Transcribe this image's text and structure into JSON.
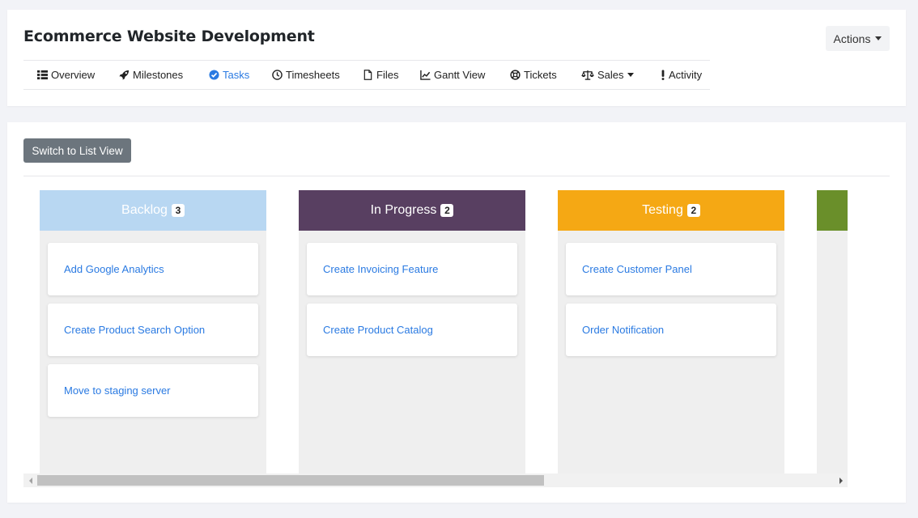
{
  "header": {
    "title": "Ecommerce Website Development",
    "actions_label": "Actions",
    "tabs": [
      {
        "label": "Overview",
        "icon": "list-icon",
        "active": false
      },
      {
        "label": "Milestones",
        "icon": "rocket-icon",
        "active": false
      },
      {
        "label": "Tasks",
        "icon": "check-circle-icon",
        "active": true
      },
      {
        "label": "Timesheets",
        "icon": "clock-icon",
        "active": false
      },
      {
        "label": "Files",
        "icon": "file-icon",
        "active": false
      },
      {
        "label": "Gantt View",
        "icon": "chart-line-icon",
        "active": false
      },
      {
        "label": "Tickets",
        "icon": "life-ring-icon",
        "active": false
      },
      {
        "label": "Sales",
        "icon": "balance-scale-icon",
        "active": false
      },
      {
        "label": "Activity",
        "icon": "exclamation-icon",
        "active": false
      }
    ]
  },
  "board": {
    "switch_label": "Switch to List View",
    "columns": [
      {
        "title": "Backlog",
        "count": "3",
        "color": "#b8d7f2",
        "tasks": [
          "Add Google Analytics",
          "Create Product Search Option",
          "Move to staging server"
        ]
      },
      {
        "title": "In Progress",
        "count": "2",
        "color": "#583f61",
        "tasks": [
          "Create Invoicing Feature",
          "Create Product Catalog"
        ]
      },
      {
        "title": "Testing",
        "count": "2",
        "color": "#f5a814",
        "tasks": [
          "Create Customer Panel",
          "Order Notification"
        ]
      },
      {
        "title": "",
        "count": "",
        "color": "#6a8f2a",
        "tasks": []
      }
    ]
  },
  "colors": {
    "link": "#2a7ae2",
    "secondary_button": "#6c757d",
    "page_background": "#f2f3f7"
  }
}
